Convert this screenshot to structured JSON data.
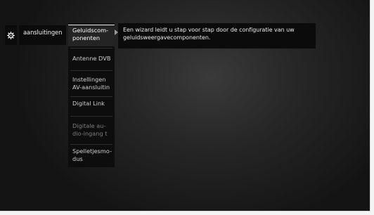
{
  "header": {
    "settings_icon": "gear-icon",
    "breadcrumb": "aansluitingen"
  },
  "menu": {
    "items": [
      {
        "line1": "Geluidscom-",
        "line2": "ponenten",
        "state": "selected"
      },
      {
        "line1": "Antenne DVB",
        "line2": "",
        "state": "normal"
      },
      {
        "line1": "Instellingen",
        "line2": "AV-aansluitin",
        "state": "normal"
      },
      {
        "line1": "Digital Link",
        "line2": "",
        "state": "normal"
      },
      {
        "line1": "Digitale au-",
        "line2": "dio-ingang t",
        "state": "dimmed"
      },
      {
        "line1": "Spelletjesmo-",
        "line2": "dus",
        "state": "normal"
      }
    ]
  },
  "description": {
    "text": "Een wizard leidt u stap voor stap door de configuratie van uw geluidsweergavecomponenten."
  },
  "colors": {
    "background_light": "#f4f4f4",
    "panel": "#0d0d0d",
    "selected_item": "#242424",
    "text": "#ececec",
    "dimmed_text": "#7c7c7c"
  }
}
